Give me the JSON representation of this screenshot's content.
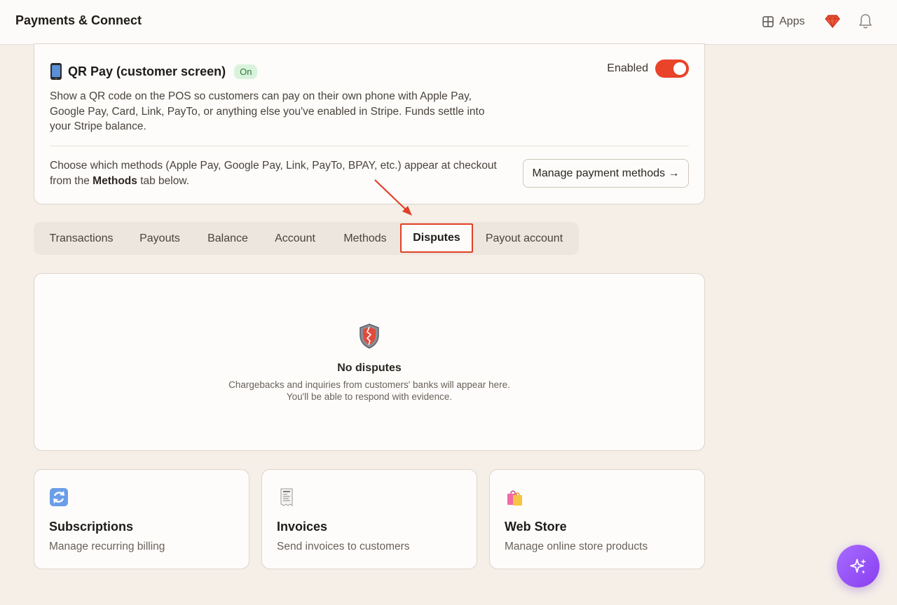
{
  "header": {
    "title": "Payments & Connect",
    "apps_label": "Apps",
    "icons": [
      "grid-icon",
      "gem-icon",
      "bell-icon"
    ]
  },
  "qr_pay": {
    "icon": "mobile-phone-icon",
    "title": "QR Pay (customer screen)",
    "status_badge": "On",
    "enabled_label": "Enabled",
    "enabled": true,
    "description": "Show a QR code on the POS so customers can pay on their own phone with Apple Pay, Google Pay, Card, Link, PayTo, or anything else you've enabled in Stripe. Funds settle into your Stripe balance.",
    "methods_note_before": "Choose which methods (Apple Pay, Google Pay, Link, PayTo, BPAY, etc.) appear at checkout from the ",
    "methods_note_bold": "Methods",
    "methods_note_after": " tab below.",
    "manage_button": "Manage payment methods →"
  },
  "tabs": [
    {
      "label": "Transactions",
      "active": false
    },
    {
      "label": "Payouts",
      "active": false
    },
    {
      "label": "Balance",
      "active": false
    },
    {
      "label": "Account",
      "active": false
    },
    {
      "label": "Methods",
      "active": false
    },
    {
      "label": "Disputes",
      "active": true
    },
    {
      "label": "Payout account",
      "active": false
    }
  ],
  "disputes": {
    "icon": "shield-icon",
    "empty_title": "No disputes",
    "empty_line1": "Chargebacks and inquiries from customers' banks will appear here.",
    "empty_line2": "You'll be able to respond with evidence."
  },
  "features": [
    {
      "icon": "refresh-icon",
      "title": "Subscriptions",
      "description": "Manage recurring billing"
    },
    {
      "icon": "receipt-icon",
      "title": "Invoices",
      "description": "Send invoices to customers"
    },
    {
      "icon": "shopping-bags-icon",
      "title": "Web Store",
      "description": "Manage online store products"
    }
  ],
  "colors": {
    "accent": "#e9432a",
    "background": "#f5efe8",
    "card": "#fdfcfa",
    "badge_bg": "#d9f2dc",
    "badge_text": "#267a35",
    "ai_button": "#9b5cf6"
  },
  "ai_button_icon": "sparkles-icon"
}
